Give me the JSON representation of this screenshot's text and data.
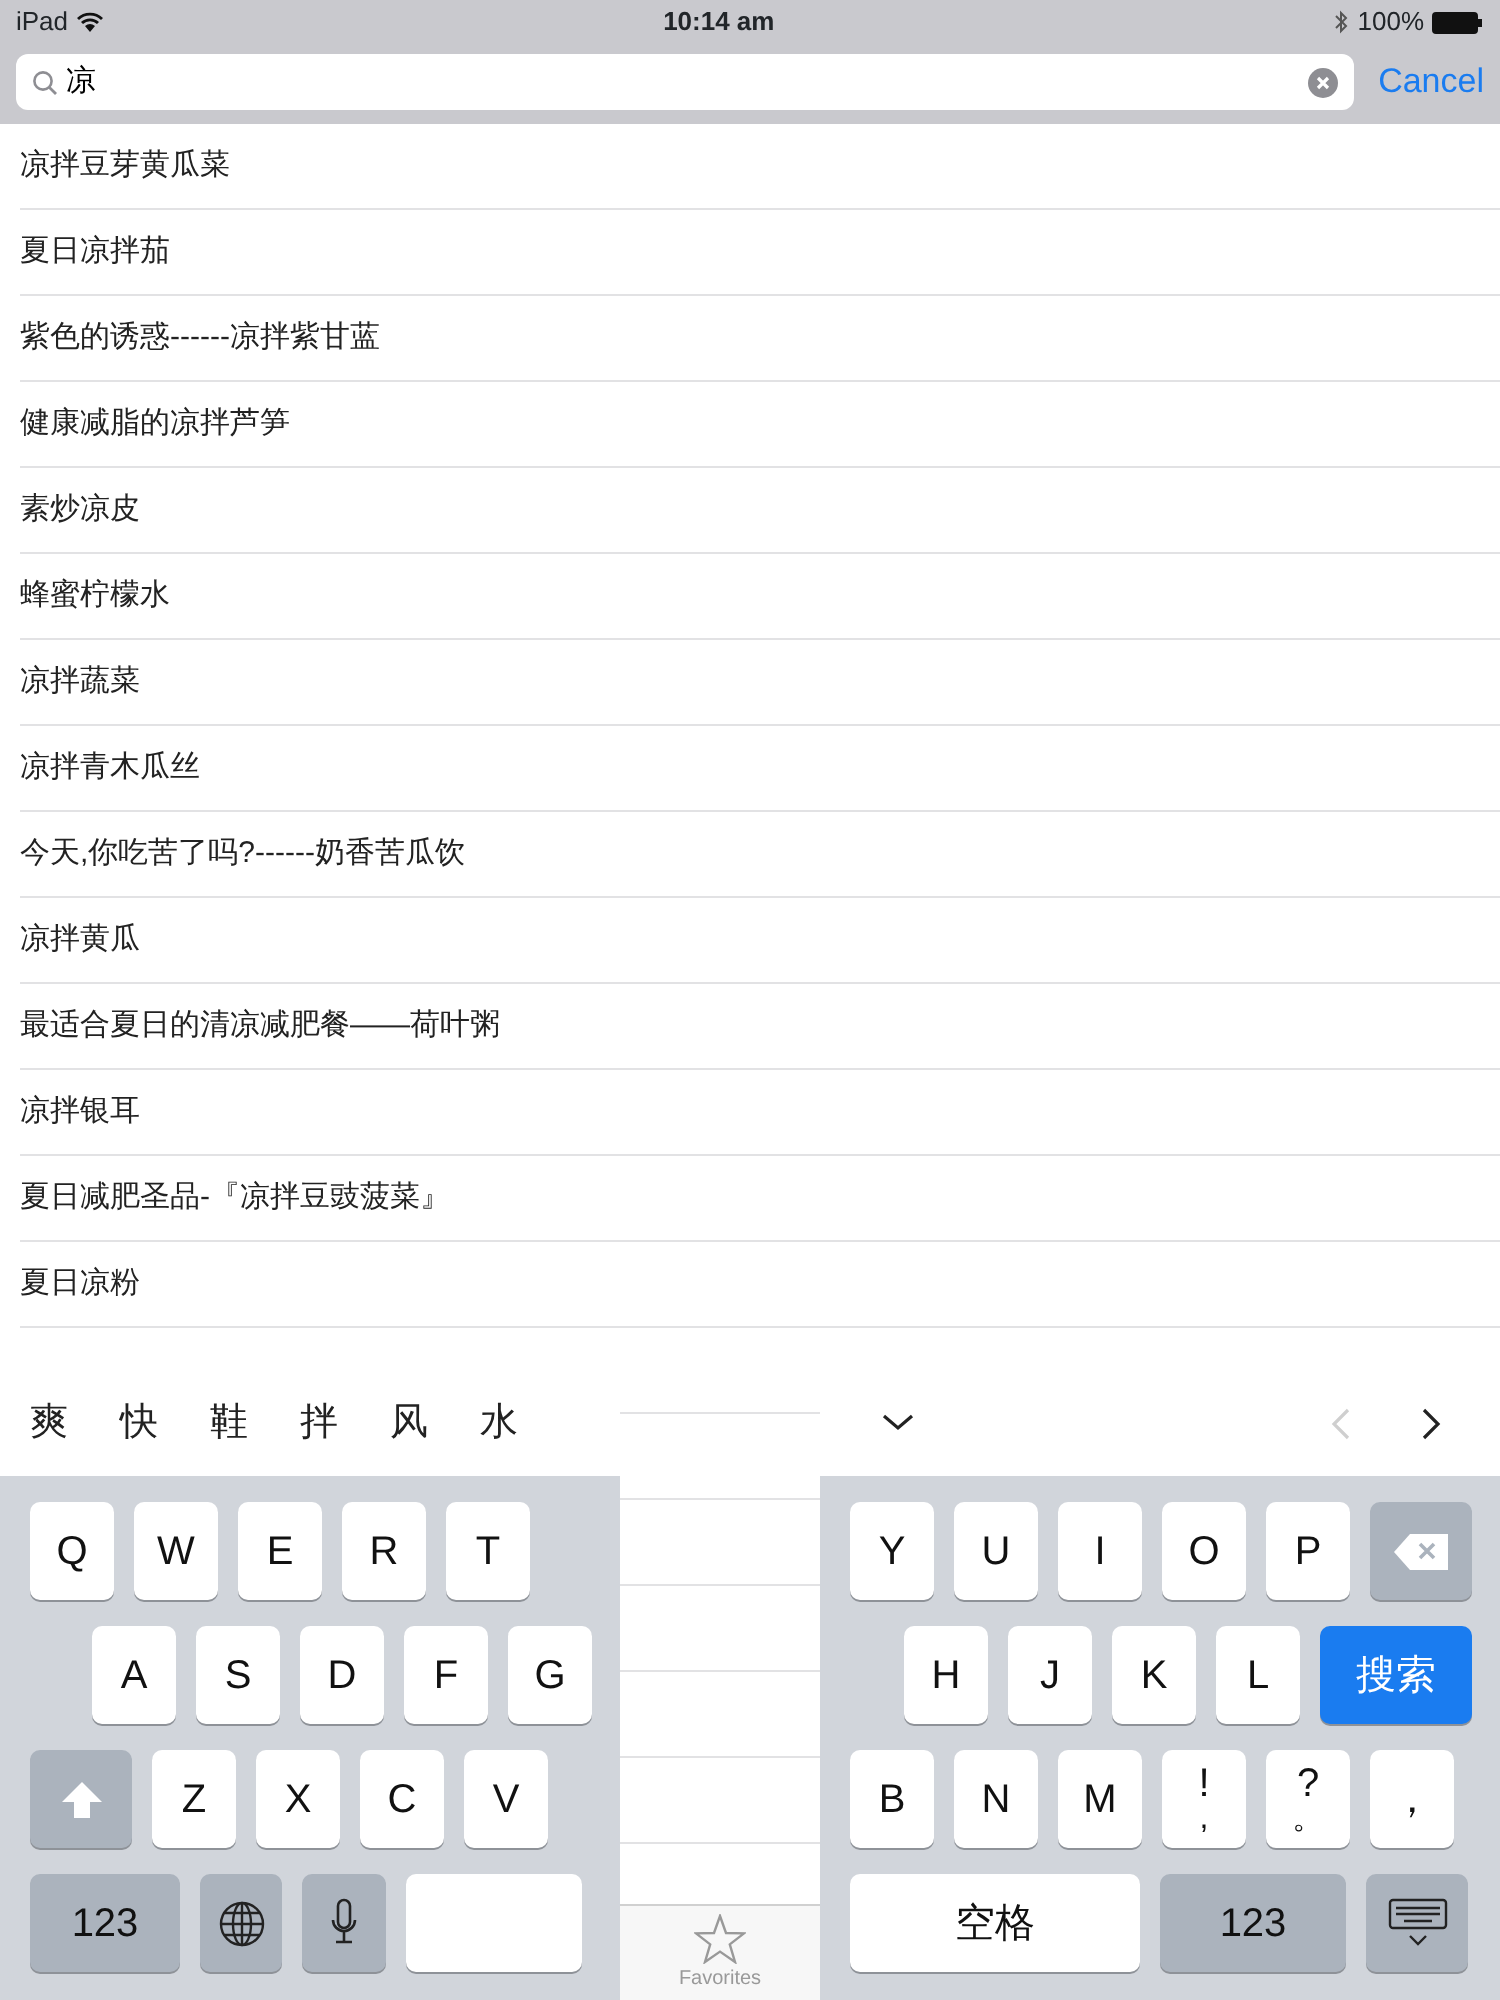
{
  "status_bar": {
    "device": "iPad",
    "time": "10:14 am",
    "battery": "100%"
  },
  "search": {
    "value": "凉",
    "cancel": "Cancel"
  },
  "results": [
    "凉拌豆芽黄瓜菜",
    "夏日凉拌茄",
    "紫色的诱惑------凉拌紫甘蓝",
    "健康减脂的凉拌芦笋",
    "素炒凉皮",
    "蜂蜜柠檬水",
    "凉拌蔬菜",
    "凉拌青木瓜丝",
    "今天,你吃苦了吗?------奶香苦瓜饮",
    "凉拌黄瓜",
    "最适合夏日的清凉减肥餐——荷叶粥",
    "凉拌银耳",
    "夏日减肥圣品-『凉拌豆豉菠菜』",
    "夏日凉粉"
  ],
  "tab_bar": {
    "items": [
      {
        "label": "Favorites",
        "selected": false
      }
    ]
  },
  "keyboard": {
    "candidates": [
      "爽",
      "快",
      "鞋",
      "拌",
      "风",
      "水"
    ],
    "nav": [
      {
        "kind": "collapse",
        "disabled": false
      },
      {
        "kind": "prev",
        "disabled": true
      },
      {
        "kind": "next",
        "disabled": false
      }
    ],
    "left_rows": [
      [
        {
          "kind": "letter",
          "label": "Q"
        },
        {
          "kind": "letter",
          "label": "W"
        },
        {
          "kind": "letter",
          "label": "E"
        },
        {
          "kind": "letter",
          "label": "R"
        },
        {
          "kind": "letter",
          "label": "T"
        }
      ],
      [
        {
          "kind": "letter",
          "label": "A"
        },
        {
          "kind": "letter",
          "label": "S"
        },
        {
          "kind": "letter",
          "label": "D"
        },
        {
          "kind": "letter",
          "label": "F"
        },
        {
          "kind": "letter",
          "label": "G"
        }
      ],
      [
        {
          "kind": "shift"
        },
        {
          "kind": "letter",
          "label": "Z"
        },
        {
          "kind": "letter",
          "label": "X"
        },
        {
          "kind": "letter",
          "label": "C"
        },
        {
          "kind": "letter",
          "label": "V"
        }
      ],
      [
        {
          "kind": "numbers",
          "label": "123"
        },
        {
          "kind": "globe"
        },
        {
          "kind": "mic"
        },
        {
          "kind": "space"
        }
      ]
    ],
    "right_rows": [
      [
        {
          "kind": "letter",
          "label": "Y"
        },
        {
          "kind": "letter",
          "label": "U"
        },
        {
          "kind": "letter",
          "label": "I"
        },
        {
          "kind": "letter",
          "label": "O"
        },
        {
          "kind": "letter",
          "label": "P"
        },
        {
          "kind": "delete"
        }
      ],
      [
        {
          "kind": "letter",
          "label": "H"
        },
        {
          "kind": "letter",
          "label": "J"
        },
        {
          "kind": "letter",
          "label": "K"
        },
        {
          "kind": "letter",
          "label": "L"
        },
        {
          "kind": "search",
          "label": "搜索"
        }
      ],
      [
        {
          "kind": "letter",
          "label": "B"
        },
        {
          "kind": "letter",
          "label": "N"
        },
        {
          "kind": "letter",
          "label": "M"
        },
        {
          "kind": "dual",
          "top": "!",
          "bottom": ","
        },
        {
          "kind": "dual",
          "top": "?",
          "bottom": "。"
        },
        {
          "kind": "letter",
          "label": "，"
        }
      ],
      [
        {
          "kind": "space",
          "label": "空格"
        },
        {
          "kind": "numbers",
          "label": "123"
        },
        {
          "kind": "hide"
        }
      ]
    ]
  }
}
